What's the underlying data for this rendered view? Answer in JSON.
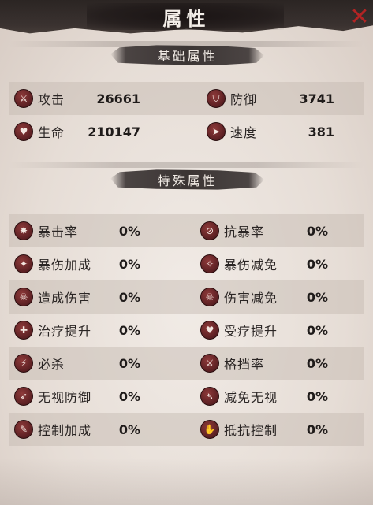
{
  "header": {
    "title": "属性"
  },
  "base_section": {
    "title": "基础属性",
    "stats": [
      {
        "name": "攻击",
        "value": "26661",
        "icon": "sword-icon"
      },
      {
        "name": "防御",
        "value": "3741",
        "icon": "shield-icon"
      },
      {
        "name": "生命",
        "value": "210147",
        "icon": "heart-icon"
      },
      {
        "name": "速度",
        "value": "381",
        "icon": "boot-icon"
      }
    ]
  },
  "special_section": {
    "title": "特殊属性",
    "stats": [
      {
        "name": "暴击率",
        "value": "0%",
        "icon": "crit-icon"
      },
      {
        "name": "抗暴率",
        "value": "0%",
        "icon": "anti-crit-icon"
      },
      {
        "name": "暴伤加成",
        "value": "0%",
        "icon": "crit-damage-icon"
      },
      {
        "name": "暴伤减免",
        "value": "0%",
        "icon": "crit-damage-reduce-icon"
      },
      {
        "name": "造成伤害",
        "value": "0%",
        "icon": "damage-dealt-icon"
      },
      {
        "name": "伤害减免",
        "value": "0%",
        "icon": "damage-reduce-icon"
      },
      {
        "name": "治疗提升",
        "value": "0%",
        "icon": "heal-boost-icon"
      },
      {
        "name": "受疗提升",
        "value": "0%",
        "icon": "heal-received-icon"
      },
      {
        "name": "必杀",
        "value": "0%",
        "icon": "finisher-icon"
      },
      {
        "name": "格挡率",
        "value": "0%",
        "icon": "block-icon"
      },
      {
        "name": "无视防御",
        "value": "0%",
        "icon": "ignore-defense-icon"
      },
      {
        "name": "减免无视",
        "value": "0%",
        "icon": "ignore-reduce-icon"
      },
      {
        "name": "控制加成",
        "value": "0%",
        "icon": "control-boost-icon"
      },
      {
        "name": "抵抗控制",
        "value": "0%",
        "icon": "control-resist-icon"
      }
    ]
  },
  "colors": {
    "accent": "#5a1f22",
    "close": "#b22424",
    "header": "#2b2523"
  }
}
